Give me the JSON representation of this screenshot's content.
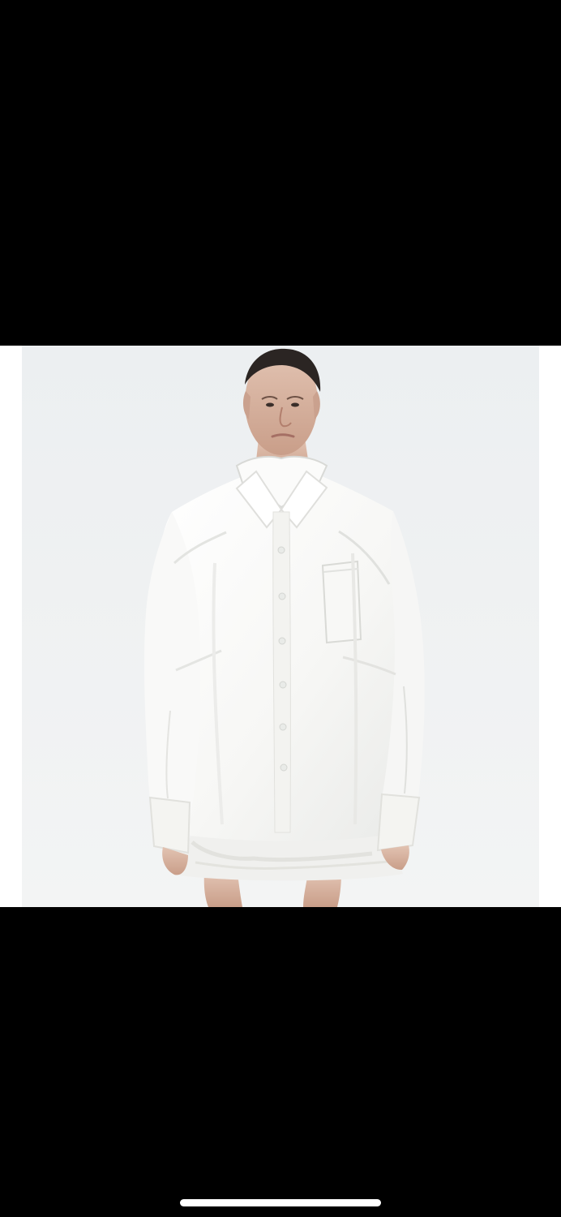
{
  "viewer": {
    "background_color": "#000000",
    "frame_color": "#ffffff",
    "photo_background_color": "#eef0f1"
  },
  "photo": {
    "subject_icon": "person-in-white-oversized-shirt-icon",
    "shirt_color": "#f8f8f6",
    "skin_color": "#d9b7a3",
    "hair_color": "#2b2523"
  },
  "home_indicator": {
    "color": "#ffffff"
  }
}
